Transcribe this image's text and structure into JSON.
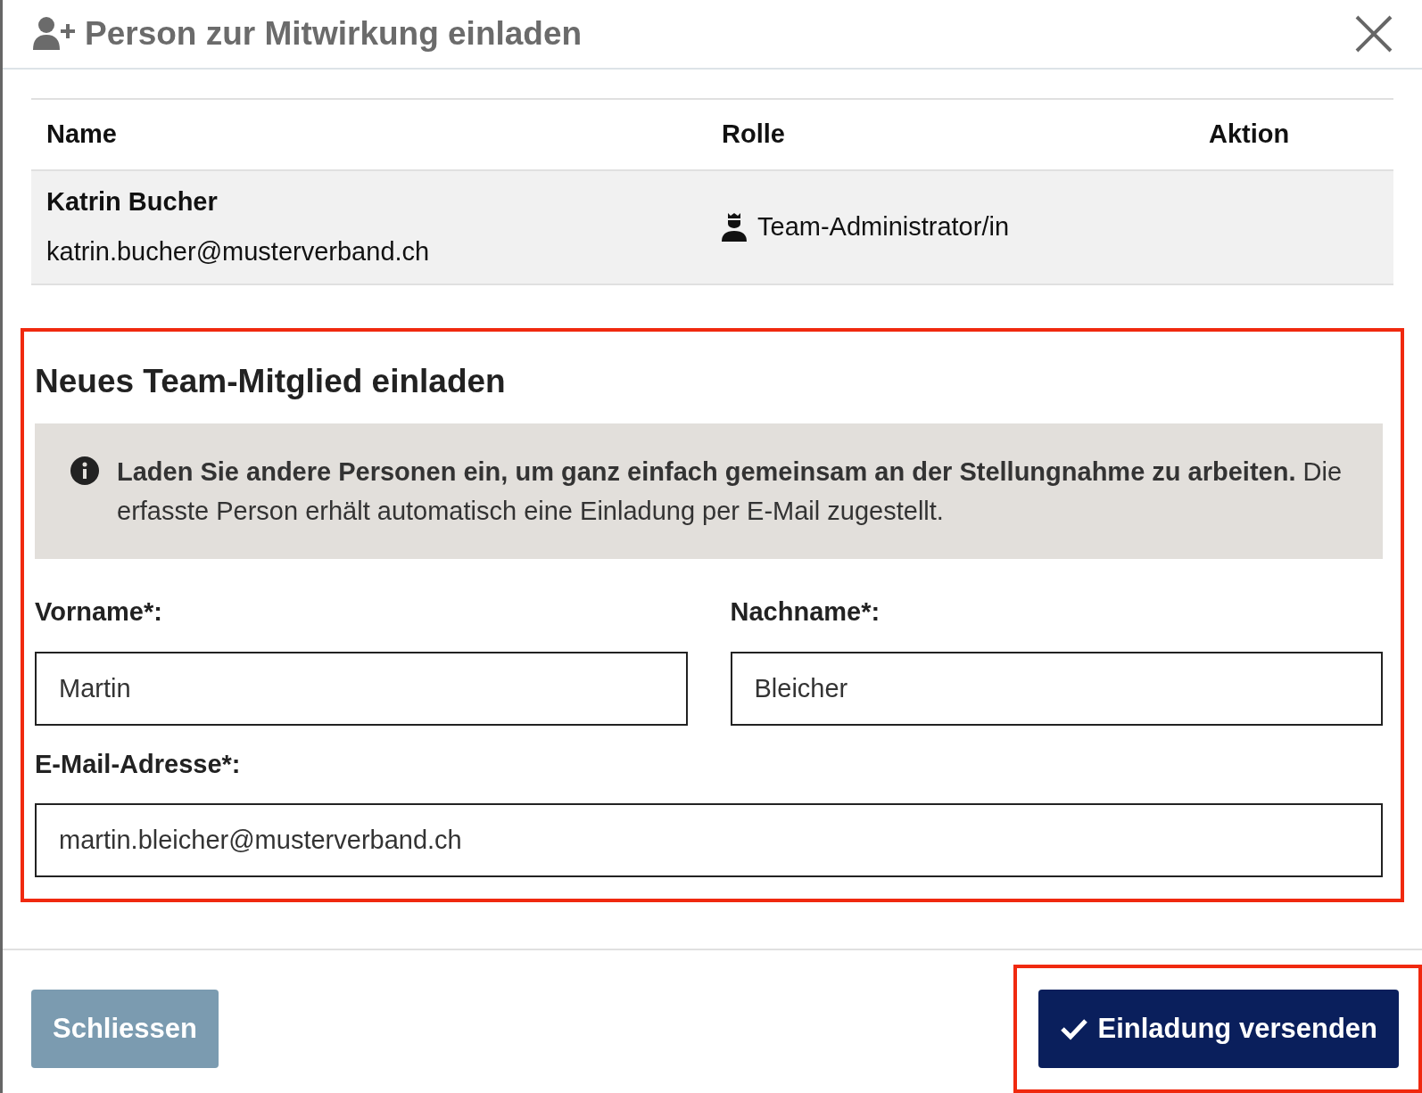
{
  "dialog": {
    "title": "Person zur Mitwirkung einladen"
  },
  "table": {
    "columns": [
      "Name",
      "Rolle",
      "Aktion"
    ],
    "rows": [
      {
        "name": "Katrin Bucher",
        "email": "katrin.bucher@musterverband.ch",
        "role": "Team-Administrator/in"
      }
    ]
  },
  "invite": {
    "heading": "Neues Team-Mitglied einladen",
    "info": "**Laden Sie andere Personen ein, um ganz einfach gemeinsam an der Stellungnahme zu arbeiten.** Die erfasste Person erhält automatisch eine Einladung per E-Mail zugestellt.",
    "fields": [
      {
        "label": "Vorname*:",
        "value": "Martin"
      },
      {
        "label": "Nachname*:",
        "value": "Bleicher"
      },
      {
        "label": "E-Mail-Adresse*:",
        "value": "martin.bleicher@musterverband.ch"
      }
    ]
  },
  "buttons": [
    {
      "label": "Schliessen",
      "kind": "secondary"
    },
    {
      "label": "Einladung versenden",
      "kind": "primary"
    }
  ]
}
